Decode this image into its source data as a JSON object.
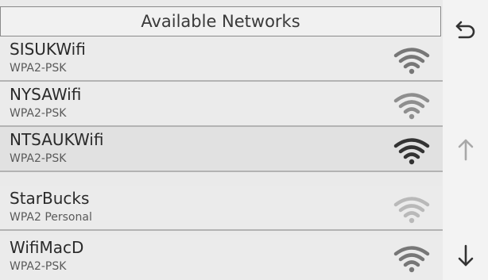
{
  "header": {
    "title": "Available Networks"
  },
  "networks": [
    {
      "name": "SISUKWifi",
      "security": "WPA2-PSK",
      "signal_color": "#777777"
    },
    {
      "name": "NYSAWifi",
      "security": "WPA2-PSK",
      "signal_color": "#8e8e8e"
    },
    {
      "name": "NTSAUKWifi",
      "security": "WPA2-PSK",
      "signal_color": "#333333"
    },
    {
      "name": "StarBucks",
      "security": "WPA2 Personal",
      "signal_color": "#b9b9b9"
    },
    {
      "name": "WifiMacD",
      "security": "WPA2-PSK",
      "signal_color": "#777777"
    }
  ],
  "nav": {
    "back_icon": "back-arrow-icon",
    "up_icon": "arrow-up-icon",
    "down_icon": "arrow-down-icon",
    "up_color": "#a8a8a8",
    "down_color": "#333333",
    "back_color": "#333333"
  }
}
